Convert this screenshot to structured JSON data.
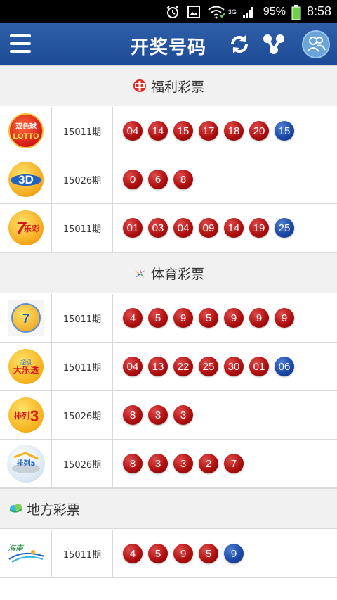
{
  "status_bar": {
    "network": "3G",
    "battery": "95%",
    "time": "8:58"
  },
  "header": {
    "title": "开奖号码"
  },
  "sections": {
    "welfare": {
      "title": "福利彩票"
    },
    "sports": {
      "title": "体育彩票"
    },
    "local": {
      "title": "地方彩票"
    }
  },
  "lotteries": [
    {
      "issue": "15011期",
      "logo": "double-color-ball-logo",
      "balls": [
        {
          "n": "04",
          "c": "red"
        },
        {
          "n": "14",
          "c": "red"
        },
        {
          "n": "15",
          "c": "red"
        },
        {
          "n": "17",
          "c": "red"
        },
        {
          "n": "18",
          "c": "red"
        },
        {
          "n": "20",
          "c": "red"
        },
        {
          "n": "15",
          "c": "blue"
        }
      ]
    },
    {
      "issue": "15026期",
      "logo": "3d-logo",
      "balls": [
        {
          "n": "0",
          "c": "red"
        },
        {
          "n": "6",
          "c": "red"
        },
        {
          "n": "8",
          "c": "red"
        }
      ]
    },
    {
      "issue": "15011期",
      "logo": "qilecai-logo",
      "balls": [
        {
          "n": "01",
          "c": "red"
        },
        {
          "n": "03",
          "c": "red"
        },
        {
          "n": "04",
          "c": "red"
        },
        {
          "n": "09",
          "c": "red"
        },
        {
          "n": "14",
          "c": "red"
        },
        {
          "n": "19",
          "c": "red"
        },
        {
          "n": "25",
          "c": "blue"
        }
      ]
    },
    {
      "issue": "15011期",
      "logo": "qixingcai-logo",
      "balls": [
        {
          "n": "4",
          "c": "red"
        },
        {
          "n": "5",
          "c": "red"
        },
        {
          "n": "9",
          "c": "red"
        },
        {
          "n": "5",
          "c": "red"
        },
        {
          "n": "9",
          "c": "red"
        },
        {
          "n": "9",
          "c": "red"
        },
        {
          "n": "9",
          "c": "red"
        }
      ]
    },
    {
      "issue": "15011期",
      "logo": "daletou-logo",
      "balls": [
        {
          "n": "04",
          "c": "red"
        },
        {
          "n": "13",
          "c": "red"
        },
        {
          "n": "22",
          "c": "red"
        },
        {
          "n": "25",
          "c": "red"
        },
        {
          "n": "30",
          "c": "red"
        },
        {
          "n": "01",
          "c": "red"
        },
        {
          "n": "06",
          "c": "blue"
        }
      ]
    },
    {
      "issue": "15026期",
      "logo": "pailie3-logo",
      "balls": [
        {
          "n": "8",
          "c": "red"
        },
        {
          "n": "3",
          "c": "red"
        },
        {
          "n": "3",
          "c": "red"
        }
      ]
    },
    {
      "issue": "15026期",
      "logo": "pailie5-logo",
      "balls": [
        {
          "n": "8",
          "c": "red"
        },
        {
          "n": "3",
          "c": "red"
        },
        {
          "n": "3",
          "c": "red"
        },
        {
          "n": "2",
          "c": "red"
        },
        {
          "n": "7",
          "c": "red"
        }
      ]
    },
    {
      "issue": "15011期",
      "logo": "hainan-logo",
      "balls": [
        {
          "n": "4",
          "c": "red"
        },
        {
          "n": "5",
          "c": "red"
        },
        {
          "n": "9",
          "c": "red"
        },
        {
          "n": "5",
          "c": "red"
        },
        {
          "n": "9",
          "c": "blue"
        }
      ]
    }
  ],
  "colors": {
    "header_blue": "#2f5fa8",
    "ball_red": "#b01010",
    "ball_blue": "#1c4aa7"
  }
}
